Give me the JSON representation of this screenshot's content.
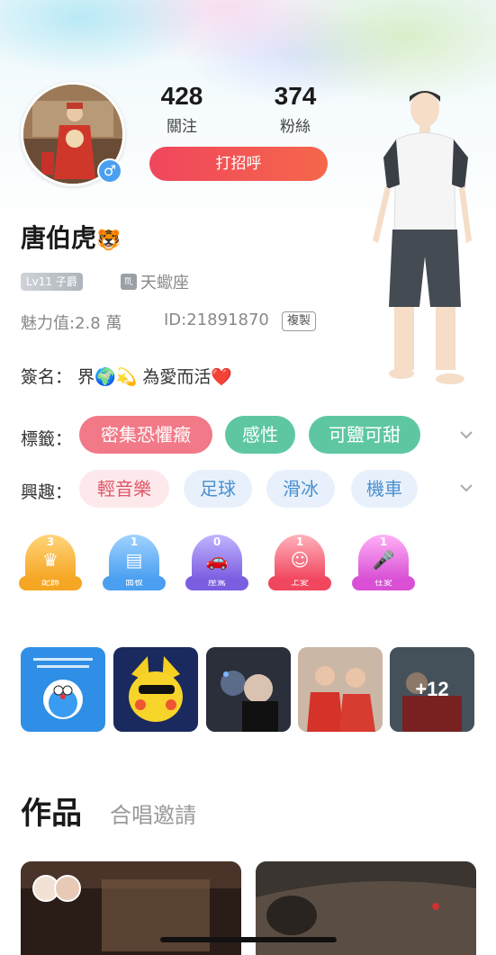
{
  "profile": {
    "name": "唐伯虎",
    "name_emoji": "🐯",
    "gender_symbol": "♂",
    "level": "Lv11 子爵",
    "zodiac_icon": "♏",
    "zodiac": "天蠍座",
    "charm": "魅力值:2.8 萬",
    "id": "ID:21891870",
    "copy_label": "複製",
    "signature": "簽名： 界🌍💫  為愛而活❤️"
  },
  "stats": {
    "following_count": "428",
    "following_label": "關注",
    "fans_count": "374",
    "fans_label": "粉絲"
  },
  "greet_button": "打招呼",
  "tags": {
    "label": "標籤：",
    "items": [
      "密集恐懼癥",
      "感性",
      "可鹽可甜"
    ]
  },
  "interests": {
    "label": "興趣：",
    "items": [
      "輕音樂",
      "足球",
      "滑冰",
      "機車"
    ]
  },
  "badges": [
    {
      "count": "3",
      "label": "配飾",
      "color": "#f5a623"
    },
    {
      "count": "1",
      "label": "面板",
      "color": "#4a9ff0"
    },
    {
      "count": "0",
      "label": "座駕",
      "color": "#7b5de0"
    },
    {
      "count": "1",
      "label": "上愛",
      "color": "#f0465e"
    },
    {
      "count": "1",
      "label": "在愛",
      "color": "#d94fd6"
    }
  ],
  "photos": {
    "more_count": "+12"
  },
  "works": {
    "tab_active": "作品",
    "tab_inactive": "合唱邀請"
  },
  "icons": {
    "dropdown": "chevron-down-icon",
    "gender": "male-icon"
  }
}
